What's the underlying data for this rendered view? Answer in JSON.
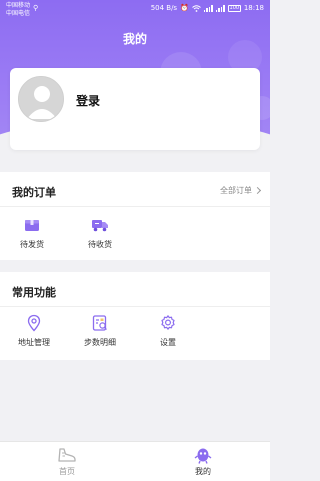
{
  "status_bar": {
    "carrier_1": "中国移动",
    "carrier_2": "中国电信",
    "speed": "504 B/s",
    "battery": "100",
    "time": "18:18"
  },
  "header": {
    "title": "我的"
  },
  "profile": {
    "login_label": "登录"
  },
  "orders": {
    "title": "我的订单",
    "all_orders_label": "全部订单",
    "items": [
      {
        "label": "待发货",
        "icon": "box-icon"
      },
      {
        "label": "待收货",
        "icon": "truck-icon"
      }
    ]
  },
  "tools": {
    "title": "常用功能",
    "items": [
      {
        "label": "地址管理",
        "icon": "location-pin-icon"
      },
      {
        "label": "步数明细",
        "icon": "steps-detail-icon"
      },
      {
        "label": "设置",
        "icon": "gear-icon"
      }
    ]
  },
  "bottom_nav": {
    "items": [
      {
        "label": "首页",
        "icon": "shoe-icon",
        "active": false
      },
      {
        "label": "我的",
        "icon": "mascot-icon",
        "active": true
      }
    ]
  },
  "colors": {
    "accent": "#8d6cf2",
    "icon_purple": "#8b6cef",
    "background": "#f1f1f4"
  }
}
